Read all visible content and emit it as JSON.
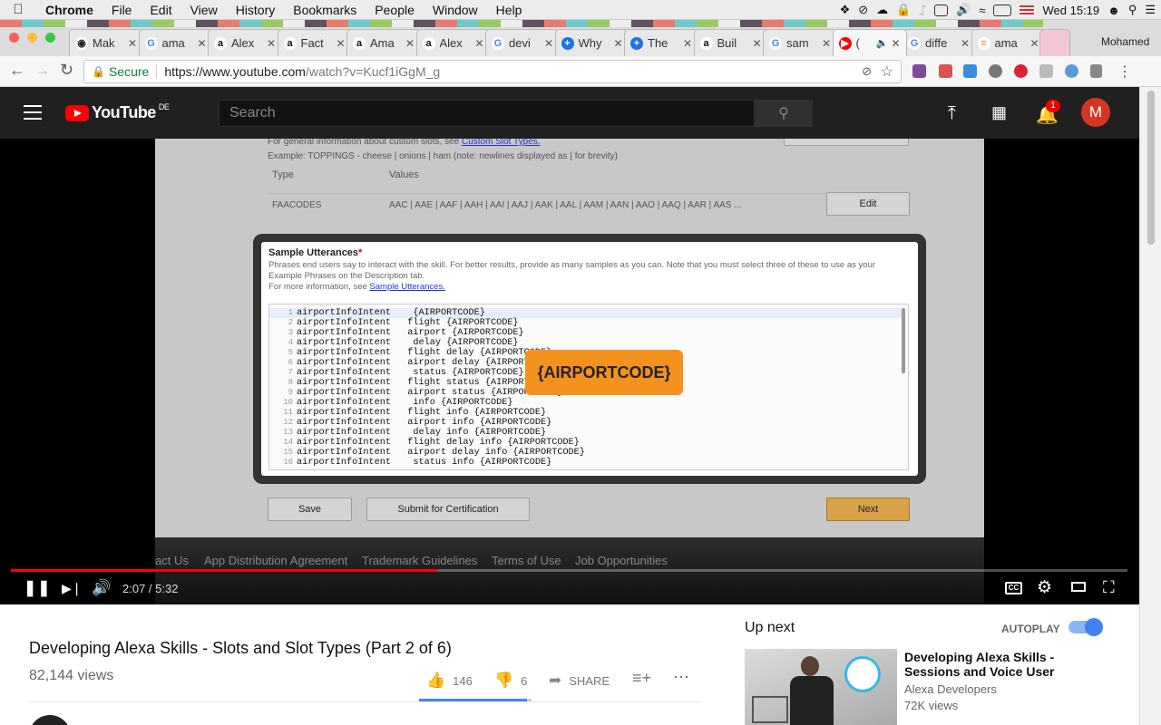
{
  "menubar": {
    "app": "Chrome",
    "items": [
      "File",
      "Edit",
      "View",
      "History",
      "Bookmarks",
      "People",
      "Window",
      "Help"
    ],
    "clock": "Wed 15:19"
  },
  "tabs": [
    {
      "title": "Mak",
      "fav": "eye-icon"
    },
    {
      "title": "ama",
      "fav": "google-icon"
    },
    {
      "title": "Alex",
      "fav": "amazon-icon"
    },
    {
      "title": "Fact",
      "fav": "amazon-icon"
    },
    {
      "title": "Ama",
      "fav": "amazon-icon"
    },
    {
      "title": "Alex",
      "fav": "amazon-icon"
    },
    {
      "title": "devi",
      "fav": "google-icon"
    },
    {
      "title": "Why",
      "fav": "plus-icon"
    },
    {
      "title": "The",
      "fav": "plus-icon"
    },
    {
      "title": "Buil",
      "fav": "amazon-icon"
    },
    {
      "title": "sam",
      "fav": "google-icon"
    },
    {
      "title": "(",
      "fav": "youtube-icon",
      "active": true
    },
    {
      "title": "diffe",
      "fav": "google-icon"
    },
    {
      "title": "ama",
      "fav": "stackoverflow-icon"
    }
  ],
  "profile_name": "Mohamed",
  "omnibox": {
    "secure": "Secure",
    "host": "https://www.youtube.com",
    "path": "/watch?v=Kucf1iGgM_g"
  },
  "youtube": {
    "logo": "YouTube",
    "region": "DE",
    "search_placeholder": "Search",
    "notifications": "1",
    "avatar_letter": "M"
  },
  "video_frame": {
    "slot_help": "For general information about custom slots, see",
    "slot_help_link": "Custom Slot Types.",
    "slot_example": "Example: TOPPINGS - cheese | onions | ham (note: newlines displayed as | for brevity)",
    "col_type": "Type",
    "col_values": "Values",
    "slot_type": "FAACODES",
    "slot_values": "AAC | AAE | AAF | AAH | AAI | AAJ | AAK | AAL | AAM | AAN | AAO | AAQ | AAR | AAS ...",
    "edit": "Edit",
    "utt_title": "Sample Utterances",
    "utt_required": "*",
    "utt_desc1": "Phrases end users say to interact with the skill. For better results, provide as many samples as you can. Note that you must select three of these to use as your",
    "utt_desc2": "Example Phrases on the Description tab.",
    "utt_more": "For more information, see",
    "utt_link": "Sample Utterances.",
    "lines": [
      {
        "n": "1",
        "t": "airportInfoIntent    {AIRPORTCODE}"
      },
      {
        "n": "2",
        "t": "airportInfoIntent   flight {AIRPORTCODE}"
      },
      {
        "n": "3",
        "t": "airportInfoIntent   airport {AIRPORTCODE}"
      },
      {
        "n": "4",
        "t": "airportInfoIntent    delay {AIRPORTCODE}"
      },
      {
        "n": "5",
        "t": "airportInfoIntent   flight delay {AIRPORTCODE}"
      },
      {
        "n": "6",
        "t": "airportInfoIntent   airport delay {AIRPORTCODE}"
      },
      {
        "n": "7",
        "t": "airportInfoIntent    status {AIRPORTCODE}"
      },
      {
        "n": "8",
        "t": "airportInfoIntent   flight status {AIRPORTCODE}"
      },
      {
        "n": "9",
        "t": "airportInfoIntent   airport status {AIRPORTCODE}"
      },
      {
        "n": "10",
        "t": "airportInfoIntent    info {AIRPORTCODE}"
      },
      {
        "n": "11",
        "t": "airportInfoIntent   flight info {AIRPORTCODE}"
      },
      {
        "n": "12",
        "t": "airportInfoIntent   airport info {AIRPORTCODE}"
      },
      {
        "n": "13",
        "t": "airportInfoIntent    delay info {AIRPORTCODE}"
      },
      {
        "n": "14",
        "t": "airportInfoIntent   flight delay info {AIRPORTCODE}"
      },
      {
        "n": "15",
        "t": "airportInfoIntent   airport delay info {AIRPORTCODE}"
      },
      {
        "n": "16",
        "t": "airportInfoIntent    status info {AIRPORTCODE}"
      }
    ],
    "badge": "{AIRPORTCODE}",
    "save": "Save",
    "submit": "Submit for Certification",
    "next": "Next",
    "footer_links": [
      "act Us",
      "App Distribution Agreement",
      "Trademark Guidelines",
      "Terms of Use",
      "Job Opportunities"
    ]
  },
  "player": {
    "time": "2:07 / 5:32",
    "played_fraction": 0.382,
    "buffered_fraction": 0.382,
    "cc": "CC"
  },
  "video_info": {
    "title": "Developing Alexa Skills - Slots and Slot Types (Part 2 of 6)",
    "views": "82,144 views",
    "likes": "146",
    "dislikes": "6",
    "share": "SHARE",
    "like_ratio": 0.96
  },
  "sidebar": {
    "up_next": "Up next",
    "autoplay": "AUTOPLAY",
    "next_title": "Developing Alexa Skills - Sessions and Voice User",
    "next_channel": "Alexa Developers",
    "next_views": "72K views"
  },
  "colors": {
    "yt_red": "#ff0000",
    "yt_header": "#202020",
    "secure_green": "#0b8043",
    "autoplay_blue": "#3e83f2",
    "badge_orange": "#f5921e"
  }
}
